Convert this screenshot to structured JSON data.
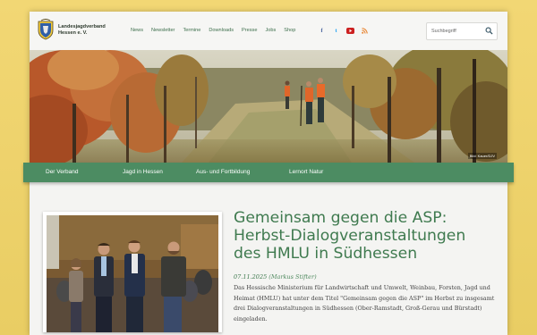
{
  "header": {
    "logo_line1": "Landesjagdverband",
    "logo_line2": "Hessen e. V.",
    "nav": [
      "News",
      "Newsletter",
      "Termine",
      "Downloads",
      "Presse",
      "Jobs",
      "Shop"
    ],
    "social": [
      {
        "icon": "facebook-icon",
        "glyph": "f",
        "color": "#3b5998"
      },
      {
        "icon": "twitter-icon",
        "glyph": "t",
        "color": "#1da1f2"
      },
      {
        "icon": "youtube-icon",
        "glyph": "▶",
        "color": "#cc2020"
      },
      {
        "icon": "rss-icon",
        "glyph": "◗",
        "color": "#e8822c"
      }
    ],
    "search_placeholder": "Suchbegriff"
  },
  "hero": {
    "credit": "Bild: Kauer/DJV"
  },
  "menu": [
    "Der Verband",
    "Jagd in Hessen",
    "Aus- und Fortbildung",
    "Lernort Natur"
  ],
  "article": {
    "title": "Gemeinsam gegen die ASP: Herbst-Dialogveranstaltungen des HMLU in Südhessen",
    "date": "07.11.2025",
    "author": "(Markus Stifter)",
    "body": "Das Hessische Ministerium für Landwirtschaft und Umwelt, Weinbau, Forsten, Jagd und Heimat (HMLU) hat unter dem Titel \"Gemeinsam gegen die ASP\" im Herbst zu insgesamt drei Dialogveranstaltungen in Südhessen (Ober-Ramstadt, Groß-Gerau und Bürstadt) eingeladen."
  },
  "colors": {
    "brand_green": "#4c8c62",
    "title_green": "#3f7a4f",
    "page_background": "#ecd06a"
  }
}
